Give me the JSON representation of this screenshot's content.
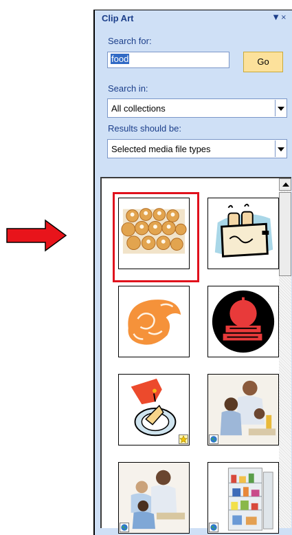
{
  "pane": {
    "title": "Clip Art",
    "menu_icon": "dropdown-arrow-icon"
  },
  "search": {
    "label": "Search for:",
    "value": "food",
    "go_label": "Go"
  },
  "search_in": {
    "label": "Search in:",
    "value": "All collections"
  },
  "results_type": {
    "label": "Results should be:",
    "value": "Selected media file types"
  },
  "results": [
    {
      "name": "doughnuts-photo",
      "badge": ""
    },
    {
      "name": "toaster-clipart",
      "badge": ""
    },
    {
      "name": "cornucopia-clipart",
      "badge": ""
    },
    {
      "name": "apple-books-clipart",
      "badge": ""
    },
    {
      "name": "birthday-cake-clipart",
      "badge": "star-badge-icon"
    },
    {
      "name": "family-cooking-photo",
      "badge": "globe-badge-icon"
    },
    {
      "name": "family-eating-photo",
      "badge": "globe-badge-icon"
    },
    {
      "name": "refrigerator-photo",
      "badge": "globe-badge-icon"
    }
  ],
  "colors": {
    "pane_bg": "#cfe0f6",
    "label_text": "#1b3e8a",
    "highlight": "#e0101c",
    "go_button": "#fce19b",
    "arrow": "#e8141b"
  }
}
